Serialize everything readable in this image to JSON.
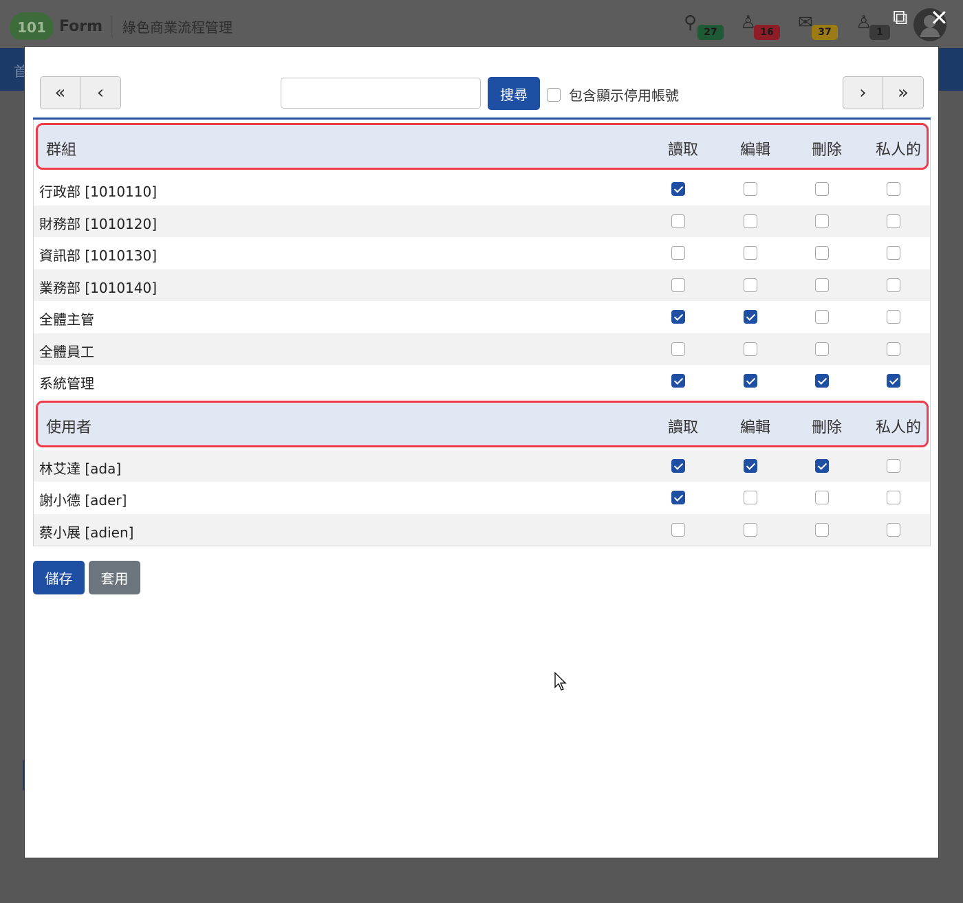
{
  "app": {
    "logo_number": "101",
    "logo_text": "Form",
    "subtitle": "綠色商業流程管理",
    "nav_text": "首",
    "notifications": [
      {
        "icon": "bell-icon",
        "glyph": "🔔",
        "count": "27",
        "color": "#1e5a35"
      },
      {
        "icon": "stamp-icon",
        "glyph": "♙",
        "count": "16",
        "color": "#8e1d27"
      },
      {
        "icon": "mail-icon",
        "glyph": "✉",
        "count": "37",
        "color": "#9c7a14"
      },
      {
        "icon": "user-icon",
        "glyph": "♙",
        "count": "1",
        "color": "#3a3a3a"
      }
    ],
    "open_external_icon": "⧉",
    "close_icon": "✕"
  },
  "toolbar": {
    "first_page": "«",
    "prev_page": "‹",
    "next_page": "›",
    "last_page": "»",
    "search_value": "",
    "search_placeholder": "",
    "search_button": "搜尋",
    "show_inactive_label": "包含顯示停用帳號",
    "show_inactive_checked": false
  },
  "groups_header": {
    "title": "群組",
    "read": "讀取",
    "edit": "編輯",
    "delete": "刪除",
    "private": "私人的"
  },
  "groups": [
    {
      "name": "行政部 [1010110]",
      "read": true,
      "edit": false,
      "delete": false,
      "private": false
    },
    {
      "name": "財務部 [1010120]",
      "read": false,
      "edit": false,
      "delete": false,
      "private": false
    },
    {
      "name": "資訊部 [1010130]",
      "read": false,
      "edit": false,
      "delete": false,
      "private": false
    },
    {
      "name": "業務部 [1010140]",
      "read": false,
      "edit": false,
      "delete": false,
      "private": false
    },
    {
      "name": "全體主管",
      "read": true,
      "edit": true,
      "delete": false,
      "private": false
    },
    {
      "name": "全體員工",
      "read": false,
      "edit": false,
      "delete": false,
      "private": false
    },
    {
      "name": "系統管理",
      "read": true,
      "edit": true,
      "delete": true,
      "private": true
    }
  ],
  "users_header": {
    "title": "使用者",
    "read": "讀取",
    "edit": "編輯",
    "delete": "刪除",
    "private": "私人的"
  },
  "users": [
    {
      "name": "林艾達 [ada]",
      "read": true,
      "edit": true,
      "delete": true,
      "private": false
    },
    {
      "name": "謝小德 [ader]",
      "read": true,
      "edit": false,
      "delete": false,
      "private": false
    },
    {
      "name": "蔡小展 [adien]",
      "read": false,
      "edit": false,
      "delete": false,
      "private": false
    }
  ],
  "actions": {
    "save": "儲存",
    "apply": "套用"
  }
}
